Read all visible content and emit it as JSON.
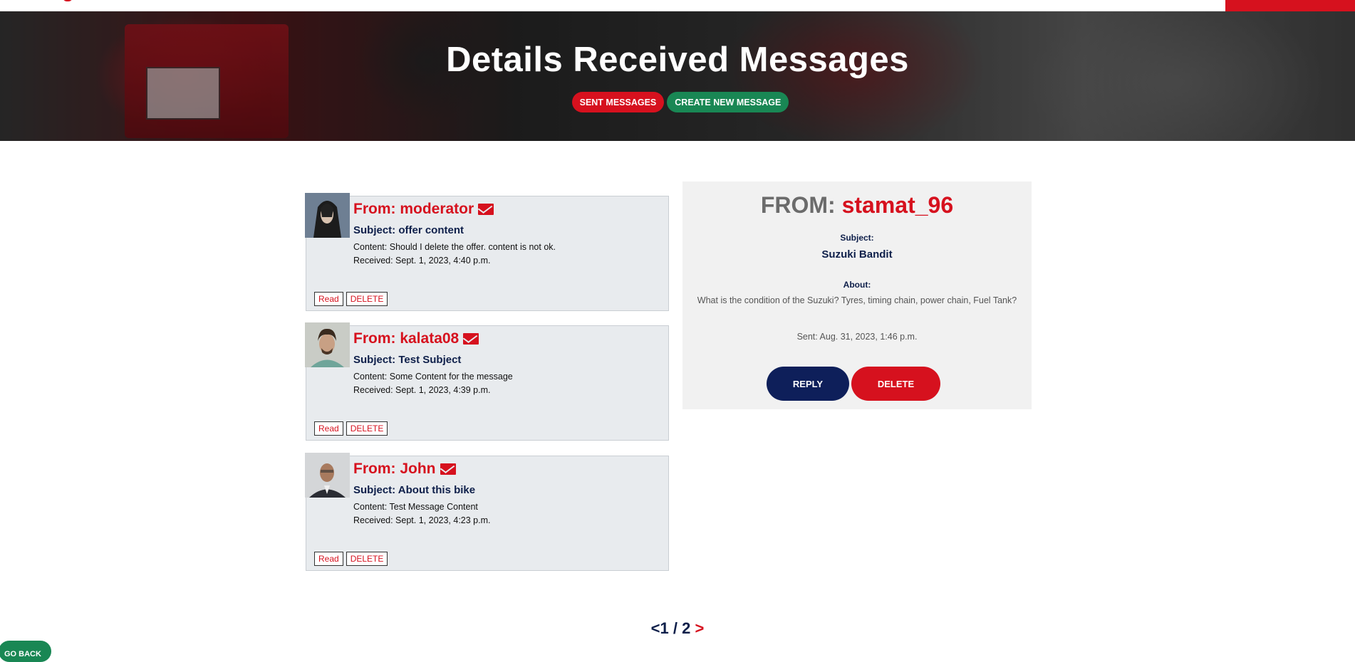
{
  "header": {
    "title": "Details Received Messages",
    "sent_messages_label": "SENT MESSAGES",
    "create_message_label": "CREATE NEW MESSAGE"
  },
  "messages": [
    {
      "from": "From: moderator",
      "subject": "Subject: offer content",
      "content": "Content: Should I delete the offer. content is not ok.",
      "received": "Received: Sept. 1, 2023, 4:40 p.m.",
      "read_label": "Read",
      "delete_label": "DELETE"
    },
    {
      "from": "From: kalata08",
      "subject": "Subject: Test Subject",
      "content": "Content: Some Content for the message",
      "received": "Received: Sept. 1, 2023, 4:39 p.m.",
      "read_label": "Read",
      "delete_label": "DELETE"
    },
    {
      "from": "From: John",
      "subject": "Subject: About this bike",
      "content": "Content: Test Message Content",
      "received": "Received: Sept. 1, 2023, 4:23 p.m.",
      "read_label": "Read",
      "delete_label": "DELETE"
    }
  ],
  "detail": {
    "from_label": "FROM:",
    "from_name": "stamat_96",
    "subject_label": "Subject:",
    "subject_value": "Suzuki Bandit",
    "about_label": "About:",
    "about_value": "What is the condition of the Suzuki? Tyres, timing chain, power chain, Fuel Tank?",
    "sent": "Sent: Aug. 31, 2023, 1:46 p.m.",
    "reply_label": "REPLY",
    "delete_label": "DELETE"
  },
  "pagination": {
    "prev": "<",
    "current": "1 / 2",
    "next": ">"
  },
  "go_back_label": "GO BACK",
  "colors": {
    "brand_red": "#d6111e",
    "navy": "#0e1f4a",
    "green": "#198754",
    "card_bg": "#e8ebee",
    "detail_bg": "#f1f1f1"
  },
  "icons": [
    "envelope-icon",
    "avatar-image"
  ]
}
